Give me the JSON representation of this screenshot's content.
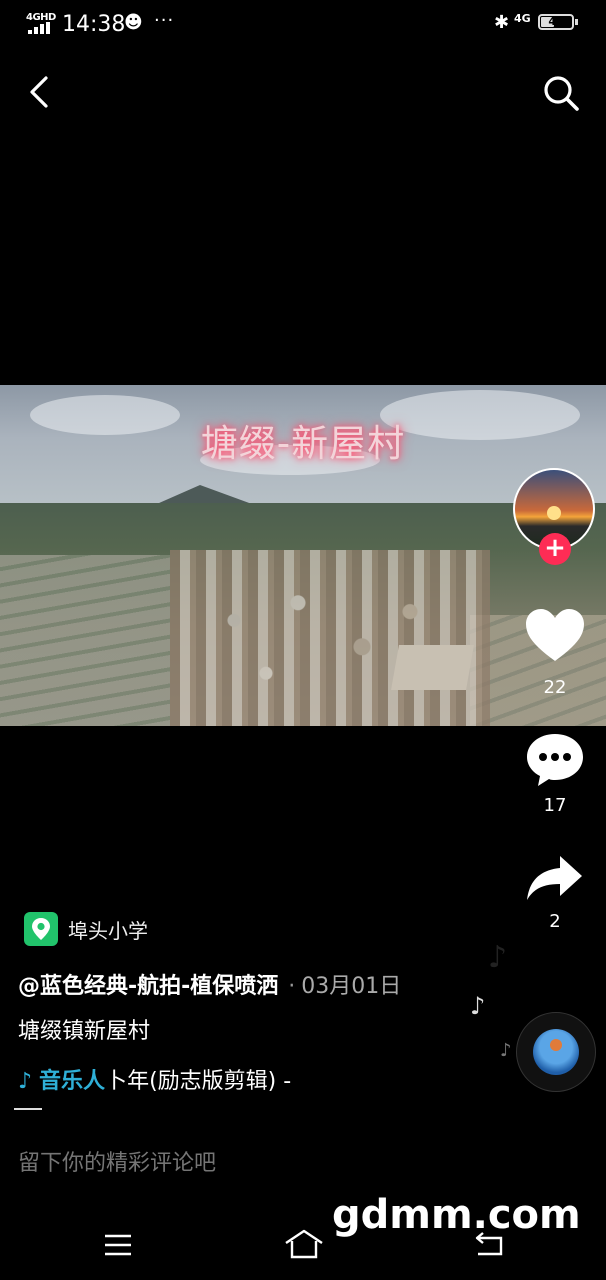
{
  "status_bar": {
    "network_type": "4GHD",
    "time": "14:38",
    "more": "···",
    "mobile_data": "4G",
    "battery": "43",
    "battery_level": 0.43
  },
  "nav": {
    "back_icon": "chevron-left-icon",
    "search_icon": "search-icon"
  },
  "video": {
    "overlay_title": "塘缀-新屋村"
  },
  "actions": {
    "like_count": "22",
    "comment_count": "17",
    "share_count": "2",
    "follow_symbol": "+"
  },
  "post": {
    "location": "埠头小学",
    "author": "@蓝色经典-航拍-植保喷洒",
    "separator": "·",
    "date": "03月01日",
    "caption": "塘缀镇新屋村",
    "music_icon": "♪",
    "music_artist": "音乐人",
    "music_title": "卜年(励志版剪辑) -"
  },
  "comment": {
    "placeholder": "留下你的精彩评论吧"
  },
  "watermark": "gdmm.com",
  "colors": {
    "accent_red": "#fe2c55",
    "music_blue": "#2fb0d8",
    "location_green": "#21c36b"
  }
}
